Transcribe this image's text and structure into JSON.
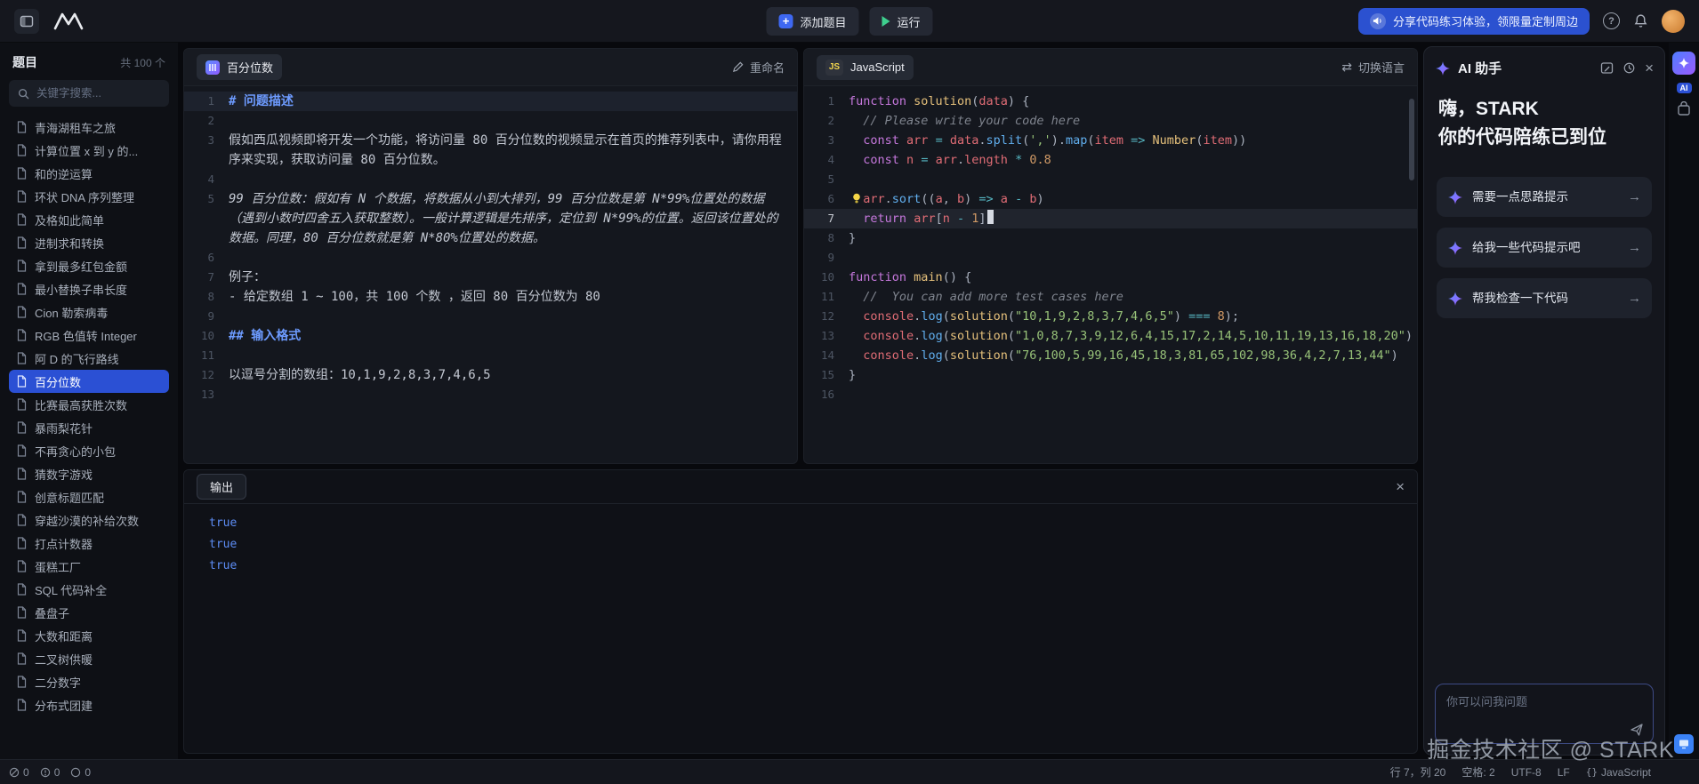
{
  "topbar": {
    "add_button": "添加题目",
    "run_button": "运行",
    "banner": "分享代码练习体验，领限量定制周边"
  },
  "sidebar": {
    "title": "题目",
    "count": "共 100 个",
    "search_placeholder": "关键字搜索...",
    "items": [
      {
        "label": "青海湖租车之旅"
      },
      {
        "label": "计算位置 x 到 y 的..."
      },
      {
        "label": "和的逆运算"
      },
      {
        "label": "环状 DNA 序列整理"
      },
      {
        "label": "及格如此简单"
      },
      {
        "label": "进制求和转换"
      },
      {
        "label": "拿到最多红包金额"
      },
      {
        "label": "最小替换子串长度"
      },
      {
        "label": "Cion 勒索病毒"
      },
      {
        "label": "RGB 色值转 Integer"
      },
      {
        "label": "阿 D 的飞行路线"
      },
      {
        "label": "百分位数",
        "selected": true
      },
      {
        "label": "比赛最高获胜次数"
      },
      {
        "label": "暴雨梨花针"
      },
      {
        "label": "不再贪心的小包"
      },
      {
        "label": "猜数字游戏"
      },
      {
        "label": "创意标题匹配"
      },
      {
        "label": "穿越沙漠的补给次数"
      },
      {
        "label": "打点计数器"
      },
      {
        "label": "蛋糕工厂"
      },
      {
        "label": "SQL 代码补全"
      },
      {
        "label": "叠盘子"
      },
      {
        "label": "大数和距离"
      },
      {
        "label": "二叉树供暖"
      },
      {
        "label": "二分数字"
      },
      {
        "label": "分布式团建"
      }
    ]
  },
  "problem": {
    "tab": "百分位数",
    "rename": "重命名",
    "lines": [
      {
        "num": 1,
        "type": "h1",
        "highlight": true,
        "text": "# 问题描述"
      },
      {
        "num": 2,
        "type": "empty",
        "text": ""
      },
      {
        "num": 3,
        "type": "p",
        "text": "假如西瓜视频即将开发一个功能，将访问量 80 百分位数的视频显示在首页的推荐列表中，请你用程序来实现，获取访问量 80 百分位数。"
      },
      {
        "num": 4,
        "type": "empty",
        "text": ""
      },
      {
        "num": 5,
        "type": "em",
        "text": "99 百分位数：假如有 N 个数据，将数据从小到大排列，99 百分位数是第 N*99%位置处的数据（遇到小数时四舍五入获取整数）。一般计算逻辑是先排序，定位到 N*99%的位置。返回该位置处的数据。同理，80 百分位数就是第 N*80%位置处的数据。"
      },
      {
        "num": 6,
        "type": "empty",
        "text": ""
      },
      {
        "num": 7,
        "type": "p",
        "text": "例子："
      },
      {
        "num": 8,
        "type": "p",
        "text": "- 给定数组 1 ~ 100，共 100 个数 ，返回 80 百分位数为 80"
      },
      {
        "num": 9,
        "type": "empty",
        "text": ""
      },
      {
        "num": 10,
        "type": "h2",
        "text": "## 输入格式"
      },
      {
        "num": 11,
        "type": "empty",
        "text": ""
      },
      {
        "num": 12,
        "type": "p",
        "text": "以逗号分割的数组：10,1,9,2,8,3,7,4,6,5"
      },
      {
        "num": 13,
        "type": "empty",
        "text": ""
      }
    ]
  },
  "editor": {
    "tab": "JavaScript",
    "tab_badge": "JS",
    "switch_lang": "切换语言",
    "lines": [
      {
        "n": 1,
        "t": [
          [
            "kw",
            "function"
          ],
          [
            "def",
            " "
          ],
          [
            "cls",
            "solution"
          ],
          [
            "pun",
            "("
          ],
          [
            "var",
            "data"
          ],
          [
            "pun",
            ") {"
          ]
        ]
      },
      {
        "n": 2,
        "t": [
          [
            "com",
            "  // Please write your code here"
          ]
        ]
      },
      {
        "n": 3,
        "t": [
          [
            "def",
            "  "
          ],
          [
            "kw",
            "const"
          ],
          [
            "def",
            " "
          ],
          [
            "var",
            "arr"
          ],
          [
            "def",
            " "
          ],
          [
            "op",
            "="
          ],
          [
            "def",
            " "
          ],
          [
            "var",
            "data"
          ],
          [
            "pun",
            "."
          ],
          [
            "fn",
            "split"
          ],
          [
            "pun",
            "("
          ],
          [
            "str",
            "','"
          ],
          [
            "pun",
            ")."
          ],
          [
            "fn",
            "map"
          ],
          [
            "pun",
            "("
          ],
          [
            "var",
            "item"
          ],
          [
            "def",
            " "
          ],
          [
            "op",
            "=>"
          ],
          [
            "def",
            " "
          ],
          [
            "cls",
            "Number"
          ],
          [
            "pun",
            "("
          ],
          [
            "var",
            "item"
          ],
          [
            "pun",
            "))"
          ]
        ]
      },
      {
        "n": 4,
        "t": [
          [
            "def",
            "  "
          ],
          [
            "kw",
            "const"
          ],
          [
            "def",
            " "
          ],
          [
            "var",
            "n"
          ],
          [
            "def",
            " "
          ],
          [
            "op",
            "="
          ],
          [
            "def",
            " "
          ],
          [
            "var",
            "arr"
          ],
          [
            "pun",
            "."
          ],
          [
            "var",
            "length"
          ],
          [
            "def",
            " "
          ],
          [
            "op",
            "*"
          ],
          [
            "def",
            " "
          ],
          [
            "num",
            "0.8"
          ]
        ]
      },
      {
        "n": 5,
        "t": []
      },
      {
        "n": 6,
        "bulb": true,
        "t": [
          [
            "def",
            "  "
          ],
          [
            "var",
            "arr"
          ],
          [
            "pun",
            "."
          ],
          [
            "fn",
            "sort"
          ],
          [
            "pun",
            "(("
          ],
          [
            "var",
            "a"
          ],
          [
            "pun",
            ", "
          ],
          [
            "var",
            "b"
          ],
          [
            "pun",
            ") "
          ],
          [
            "op",
            "=>"
          ],
          [
            "def",
            " "
          ],
          [
            "var",
            "a"
          ],
          [
            "def",
            " "
          ],
          [
            "op",
            "-"
          ],
          [
            "def",
            " "
          ],
          [
            "var",
            "b"
          ],
          [
            "pun",
            ")"
          ]
        ]
      },
      {
        "n": 7,
        "current": true,
        "caret": true,
        "t": [
          [
            "def",
            "  "
          ],
          [
            "kw",
            "return"
          ],
          [
            "def",
            " "
          ],
          [
            "var",
            "arr"
          ],
          [
            "pun",
            "["
          ],
          [
            "var",
            "n"
          ],
          [
            "def",
            " "
          ],
          [
            "op",
            "-"
          ],
          [
            "def",
            " "
          ],
          [
            "num",
            "1"
          ],
          [
            "pun",
            "]"
          ]
        ]
      },
      {
        "n": 8,
        "t": [
          [
            "pun",
            "}"
          ]
        ]
      },
      {
        "n": 9,
        "t": []
      },
      {
        "n": 10,
        "t": [
          [
            "kw",
            "function"
          ],
          [
            "def",
            " "
          ],
          [
            "cls",
            "main"
          ],
          [
            "pun",
            "() {"
          ]
        ]
      },
      {
        "n": 11,
        "t": [
          [
            "com",
            "  //  You can add more test cases here"
          ]
        ]
      },
      {
        "n": 12,
        "t": [
          [
            "def",
            "  "
          ],
          [
            "var",
            "console"
          ],
          [
            "pun",
            "."
          ],
          [
            "fn",
            "log"
          ],
          [
            "pun",
            "("
          ],
          [
            "cls",
            "solution"
          ],
          [
            "pun",
            "("
          ],
          [
            "str",
            "\"10,1,9,2,8,3,7,4,6,5\""
          ],
          [
            "pun",
            ") "
          ],
          [
            "op",
            "==="
          ],
          [
            "def",
            " "
          ],
          [
            "num",
            "8"
          ],
          [
            "pun",
            ");"
          ]
        ]
      },
      {
        "n": 13,
        "t": [
          [
            "def",
            "  "
          ],
          [
            "var",
            "console"
          ],
          [
            "pun",
            "."
          ],
          [
            "fn",
            "log"
          ],
          [
            "pun",
            "("
          ],
          [
            "cls",
            "solution"
          ],
          [
            "pun",
            "("
          ],
          [
            "str",
            "\"1,0,8,7,3,9,12,6,4,15,17,2,14,5,10,11,19,13,16,18,20\""
          ],
          [
            "pun",
            ")"
          ]
        ]
      },
      {
        "n": 14,
        "t": [
          [
            "def",
            "  "
          ],
          [
            "var",
            "console"
          ],
          [
            "pun",
            "."
          ],
          [
            "fn",
            "log"
          ],
          [
            "pun",
            "("
          ],
          [
            "cls",
            "solution"
          ],
          [
            "pun",
            "("
          ],
          [
            "str",
            "\"76,100,5,99,16,45,18,3,81,65,102,98,36,4,2,7,13,44\""
          ],
          [
            "pun",
            ")"
          ]
        ]
      },
      {
        "n": 15,
        "t": [
          [
            "pun",
            "}"
          ]
        ]
      },
      {
        "n": 16,
        "t": []
      }
    ]
  },
  "output": {
    "tab": "输出",
    "lines": [
      "true",
      "true",
      "true"
    ]
  },
  "ai": {
    "title": "AI 助手",
    "greeting1": "嗨，STARK",
    "greeting2": "你的代码陪练已到位",
    "suggestions": [
      "需要一点思路提示",
      "给我一些代码提示吧",
      "帮我检查一下代码"
    ],
    "arrow": "→",
    "input_placeholder": "你可以问我问题",
    "strip_label": "AI",
    "watermark": "掘金技术社区 @ STARK"
  },
  "statusbar": {
    "problems": [
      "0",
      "0",
      "0"
    ],
    "cursor": "行 7，列 20",
    "spaces": "空格: 2",
    "encoding": "UTF-8",
    "eol": "LF",
    "braces": "{}",
    "language": "JavaScript"
  }
}
